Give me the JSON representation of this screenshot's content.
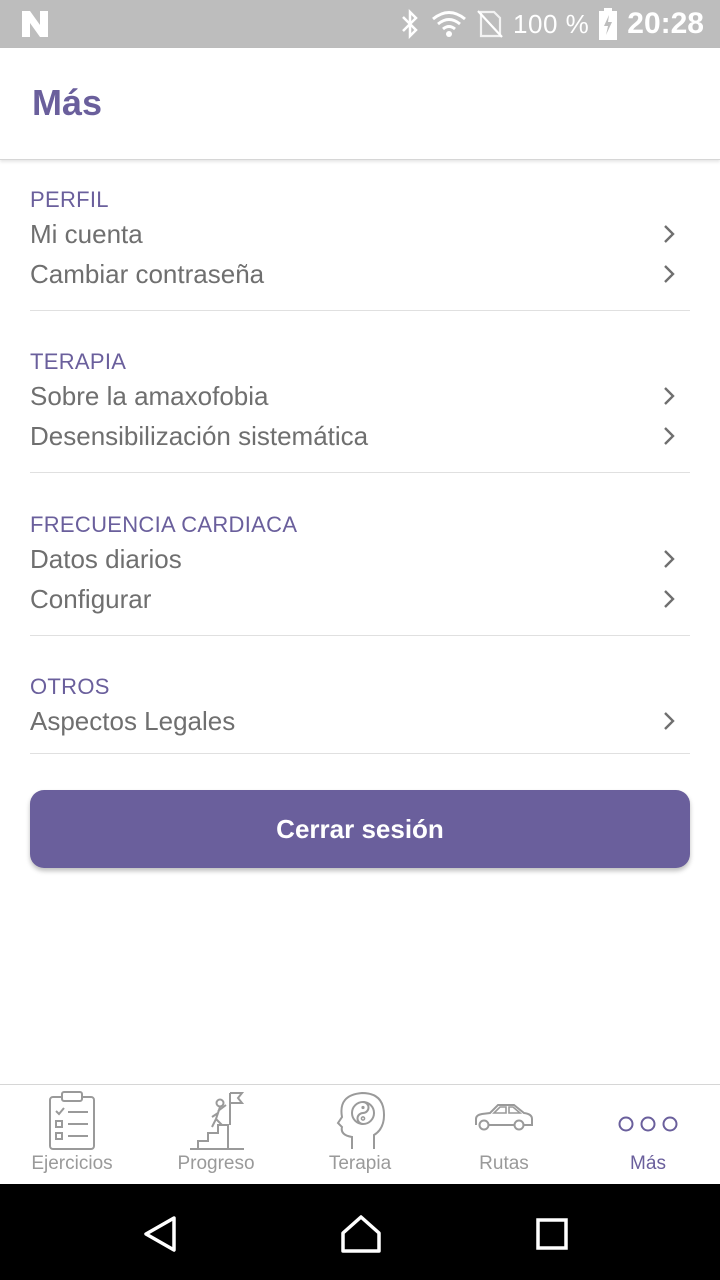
{
  "status_bar": {
    "battery_percent": "100 %",
    "time": "20:28",
    "icons": [
      "n-notification-icon",
      "bluetooth-icon",
      "wifi-icon",
      "no-sim-icon",
      "battery-charging-icon"
    ]
  },
  "header": {
    "title": "Más"
  },
  "sections": [
    {
      "header": "PERFIL",
      "items": [
        {
          "label": "Mi cuenta"
        },
        {
          "label": "Cambiar contraseña"
        }
      ]
    },
    {
      "header": "TERAPIA",
      "items": [
        {
          "label": "Sobre la amaxofobia"
        },
        {
          "label": "Desensibilización sistemática"
        }
      ]
    },
    {
      "header": "FRECUENCIA CARDIACA",
      "items": [
        {
          "label": "Datos diarios"
        },
        {
          "label": "Configurar"
        }
      ]
    },
    {
      "header": "OTROS",
      "items": [
        {
          "label": "Aspectos Legales"
        }
      ]
    }
  ],
  "logout_button": {
    "label": "Cerrar sesión"
  },
  "bottom_nav": {
    "items": [
      {
        "label": "Ejercicios",
        "icon": "clipboard-checklist-icon",
        "active": false
      },
      {
        "label": "Progreso",
        "icon": "climbing-stairs-flag-icon",
        "active": false
      },
      {
        "label": "Terapia",
        "icon": "head-yin-yang-icon",
        "active": false
      },
      {
        "label": "Rutas",
        "icon": "car-icon",
        "active": false
      },
      {
        "label": "Más",
        "icon": "more-dots-icon",
        "active": true
      }
    ]
  },
  "system_nav": {
    "icons": [
      "back-icon",
      "home-icon",
      "recents-icon"
    ]
  },
  "colors": {
    "accent": "#6a5f9c",
    "text_gray": "#6f6f6f",
    "inactive_gray": "#9a9a9a",
    "status_bar": "#bdbdbd"
  }
}
